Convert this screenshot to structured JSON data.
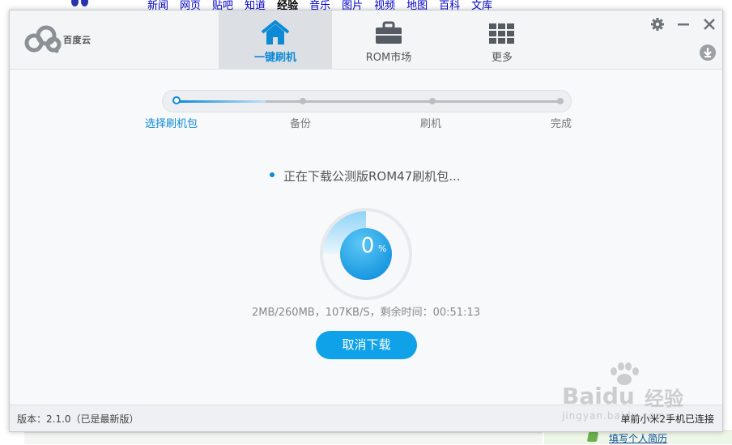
{
  "background": {
    "nav_links": [
      "新闻",
      "网页",
      "贴吧",
      "知道",
      "经验",
      "音乐",
      "图片",
      "视频",
      "地图",
      "百科",
      "文库"
    ],
    "active_link": "经验",
    "footer_link": "填写个人简历"
  },
  "app": {
    "logo_text": "百度云",
    "tabs": [
      {
        "label": "一键刷机",
        "icon": "home-icon",
        "active": true
      },
      {
        "label": "ROM市场",
        "icon": "briefcase-icon",
        "active": false
      },
      {
        "label": "更多",
        "icon": "grid-icon",
        "active": false
      }
    ],
    "steps": [
      "选择刷机包",
      "备份",
      "刷机",
      "完成"
    ],
    "current_step": 0,
    "status_text": "正在下载公测版ROM47刷机包...",
    "progress_percent": 0,
    "percent_sign": "%",
    "download_info": "2MB/260MB，107KB/S，剩余时间：00:51:13",
    "cancel_label": "取消下载",
    "version": "版本：2.1.0（已是最新版）",
    "connection_status": "单前小米2手机已连接",
    "accent_color": "#0c8ad6"
  },
  "watermark": {
    "brand": "Baidu",
    "brand_cn": "经验",
    "sub": "jingyan.baidu.com"
  }
}
